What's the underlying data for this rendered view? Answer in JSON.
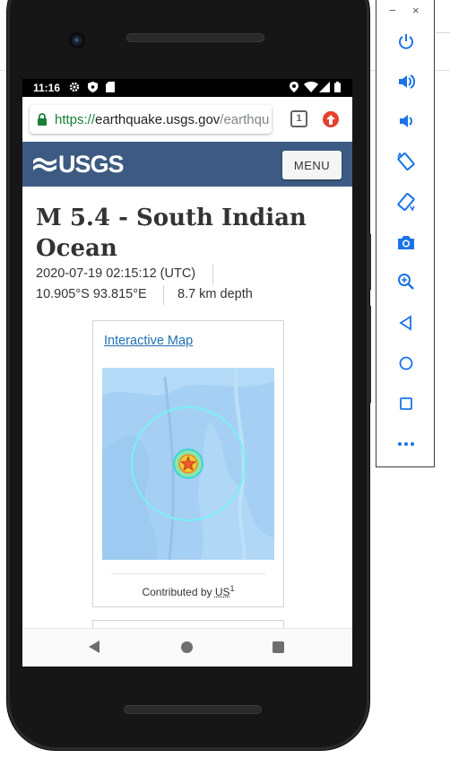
{
  "status_bar": {
    "time": "11:16"
  },
  "browser": {
    "url_scheme": "https://",
    "url_host": "earthquake.usgs.gov",
    "url_path": "/earthqu",
    "tab_count": "1"
  },
  "site_header": {
    "logo_text": "USGS",
    "menu_label": "MENU"
  },
  "event": {
    "title": "M 5.4 - South Indian Ocean",
    "datetime": "2020-07-19 02:15:12 (UTC)",
    "coordinates": "10.905°S 93.815°E",
    "depth": "8.7 km depth"
  },
  "map_card": {
    "link_label": "Interactive Map",
    "caption_prefix": "Contributed by ",
    "caption_source": "US",
    "caption_sup": "1"
  },
  "emulator_toolbar": {
    "minimize_label": "−",
    "close_label": "×",
    "buttons": [
      "power-icon",
      "volume-up-icon",
      "volume-down-icon",
      "rotate-left-icon",
      "rotate-right-icon",
      "camera-icon",
      "zoom-icon",
      "back-icon",
      "home-icon",
      "overview-icon",
      "more-icon"
    ]
  },
  "colors": {
    "usgs_blue": "#3d5b82",
    "link_blue": "#1f6fb2",
    "url_green": "#188038",
    "update_red": "#e5412f",
    "emulator_icon_blue": "#1a73e8"
  }
}
